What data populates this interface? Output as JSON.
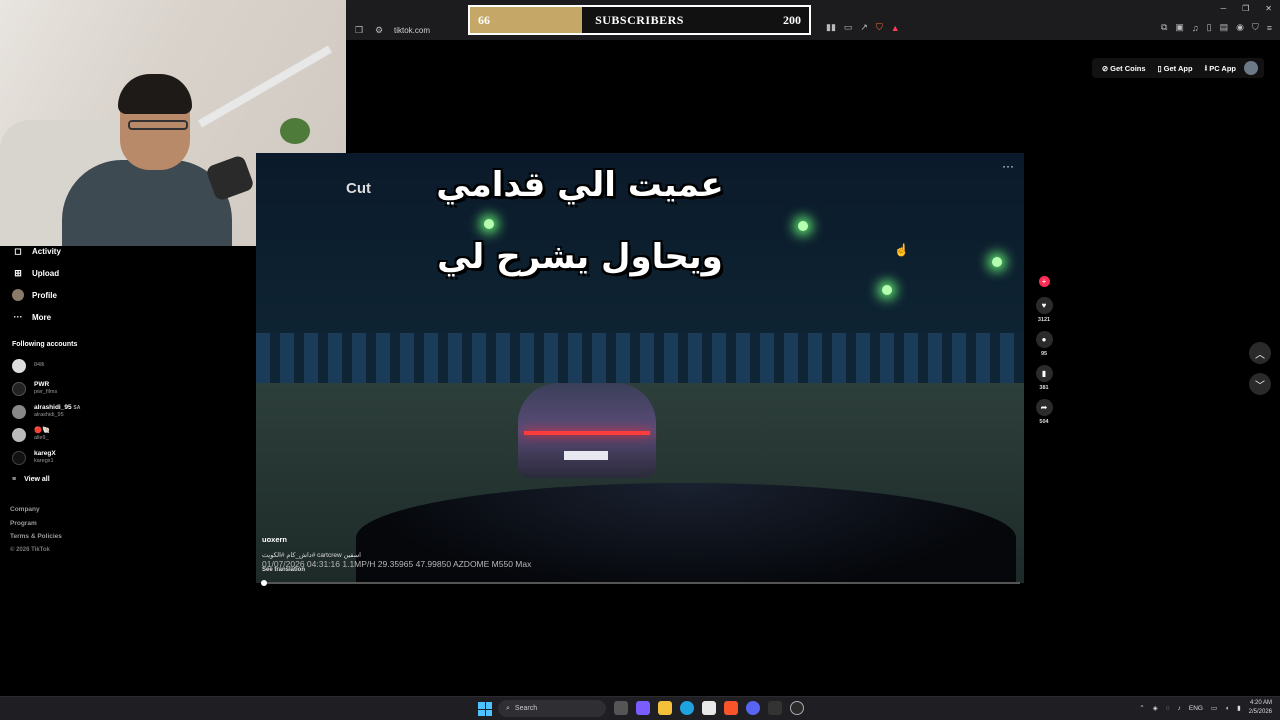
{
  "browser": {
    "url": "tiktok.com",
    "window_controls": [
      "─",
      "❐",
      "✕"
    ]
  },
  "overlay": {
    "current": "66",
    "label": "SUBSCRIBERS",
    "goal": "200",
    "progress_fraction": 0.33,
    "fill_color": "#c5a867"
  },
  "topbar": {
    "get_coins": "Get Coins",
    "get_app": "Get App",
    "pc_app": "PC App"
  },
  "sidebar": {
    "items": [
      {
        "label": "Activity",
        "icon": "bell-icon"
      },
      {
        "label": "Upload",
        "icon": "plus-square-icon"
      },
      {
        "label": "Profile",
        "icon": "avatar-icon"
      },
      {
        "label": "More",
        "icon": "more-icon"
      }
    ],
    "following_title": "Following accounts",
    "accounts": [
      {
        "name": "",
        "handle": "848i"
      },
      {
        "name": "PWR",
        "handle": "pwr_films"
      },
      {
        "name": "alrashidi_95",
        "handle": "alrashidi_95",
        "badge": "SA"
      },
      {
        "name": "🔴🐚",
        "handle": "alle9_"
      },
      {
        "name": "karegX",
        "handle": "karegx1"
      }
    ],
    "view_all": "View all",
    "footer": [
      "Company",
      "Program",
      "Terms & Policies",
      "© 2026 TikTok"
    ]
  },
  "video": {
    "caption_line1": "عميت الي قدامي",
    "caption_line2": "ويحاول يشرح لي",
    "cut_label": "Cut",
    "author": "uoxern",
    "description": "داش_كام #الكويت# cartcrew اسفين",
    "see_translation": "See translation",
    "dashcam_text": "01/07/2026 04:31:16   1.1MP/H  29.35965  47.99850  AZDOME M550 Max",
    "progress_fraction": 0.0
  },
  "actions": {
    "likes": "3121",
    "comments": "95",
    "saves": "381",
    "shares": "504"
  },
  "taskbar": {
    "search_placeholder": "Search",
    "lang": "ENG",
    "time": "4:20 AM",
    "date": "2/5/2026"
  }
}
